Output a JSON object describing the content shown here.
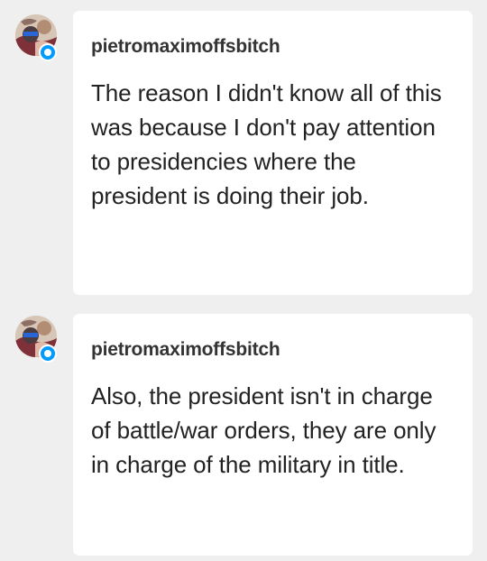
{
  "messages": [
    {
      "username": "pietromaximoffsbitch",
      "text": "The reason I didn't know all of this was because I don't pay attention to presidencies where the president is doing their job.",
      "avatar_icon": "user-avatar-icon",
      "badge_icon": "chat-badge-icon",
      "badge_color": "#009bff"
    },
    {
      "username": "pietromaximoffsbitch",
      "text": "Also, the president isn't in charge of battle/war orders, they are only in charge of the military in title.",
      "avatar_icon": "user-avatar-icon",
      "badge_icon": "chat-badge-icon",
      "badge_color": "#009bff"
    }
  ],
  "colors": {
    "background": "#efefef",
    "bubble": "#ffffff",
    "username": "#333333",
    "text": "#222222"
  }
}
